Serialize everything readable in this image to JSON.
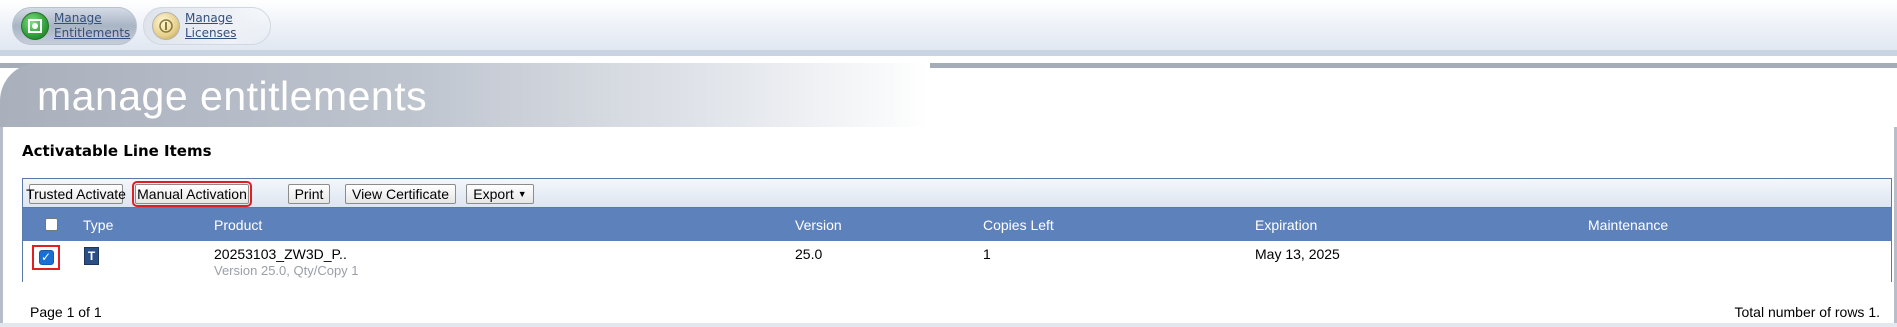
{
  "nav": {
    "tabs": [
      {
        "label_line1": "Manage",
        "label_line2": "Entitlements",
        "icon": "entitlements-icon",
        "active": true
      },
      {
        "label_line1": "Manage",
        "label_line2": "Licenses",
        "icon": "licenses-icon",
        "active": false
      }
    ]
  },
  "page": {
    "title": "manage entitlements"
  },
  "section": {
    "title": "Activatable Line Items"
  },
  "toolbar": {
    "trusted_activate": "Trusted Activate",
    "manual_activation": "Manual Activation",
    "print": "Print",
    "view_certificate": "View Certificate",
    "export": "Export"
  },
  "table": {
    "columns": [
      "Type",
      "Product",
      "Version",
      "Copies Left",
      "Expiration",
      "Maintenance"
    ],
    "rows": [
      {
        "selected": true,
        "type_glyph": "T",
        "product": "20253103_ZW3D_P..",
        "product_sub": "Version 25.0, Qty/Copy 1",
        "version": "25.0",
        "copies_left": "1",
        "expiration": "May 13, 2025",
        "maintenance": ""
      }
    ]
  },
  "footer": {
    "page_info": "Page 1 of 1",
    "total_rows": "Total number of rows 1."
  },
  "colors": {
    "header_row": "#5d82bb",
    "highlight": "#e02020",
    "type_icon": "#2a4f86"
  }
}
